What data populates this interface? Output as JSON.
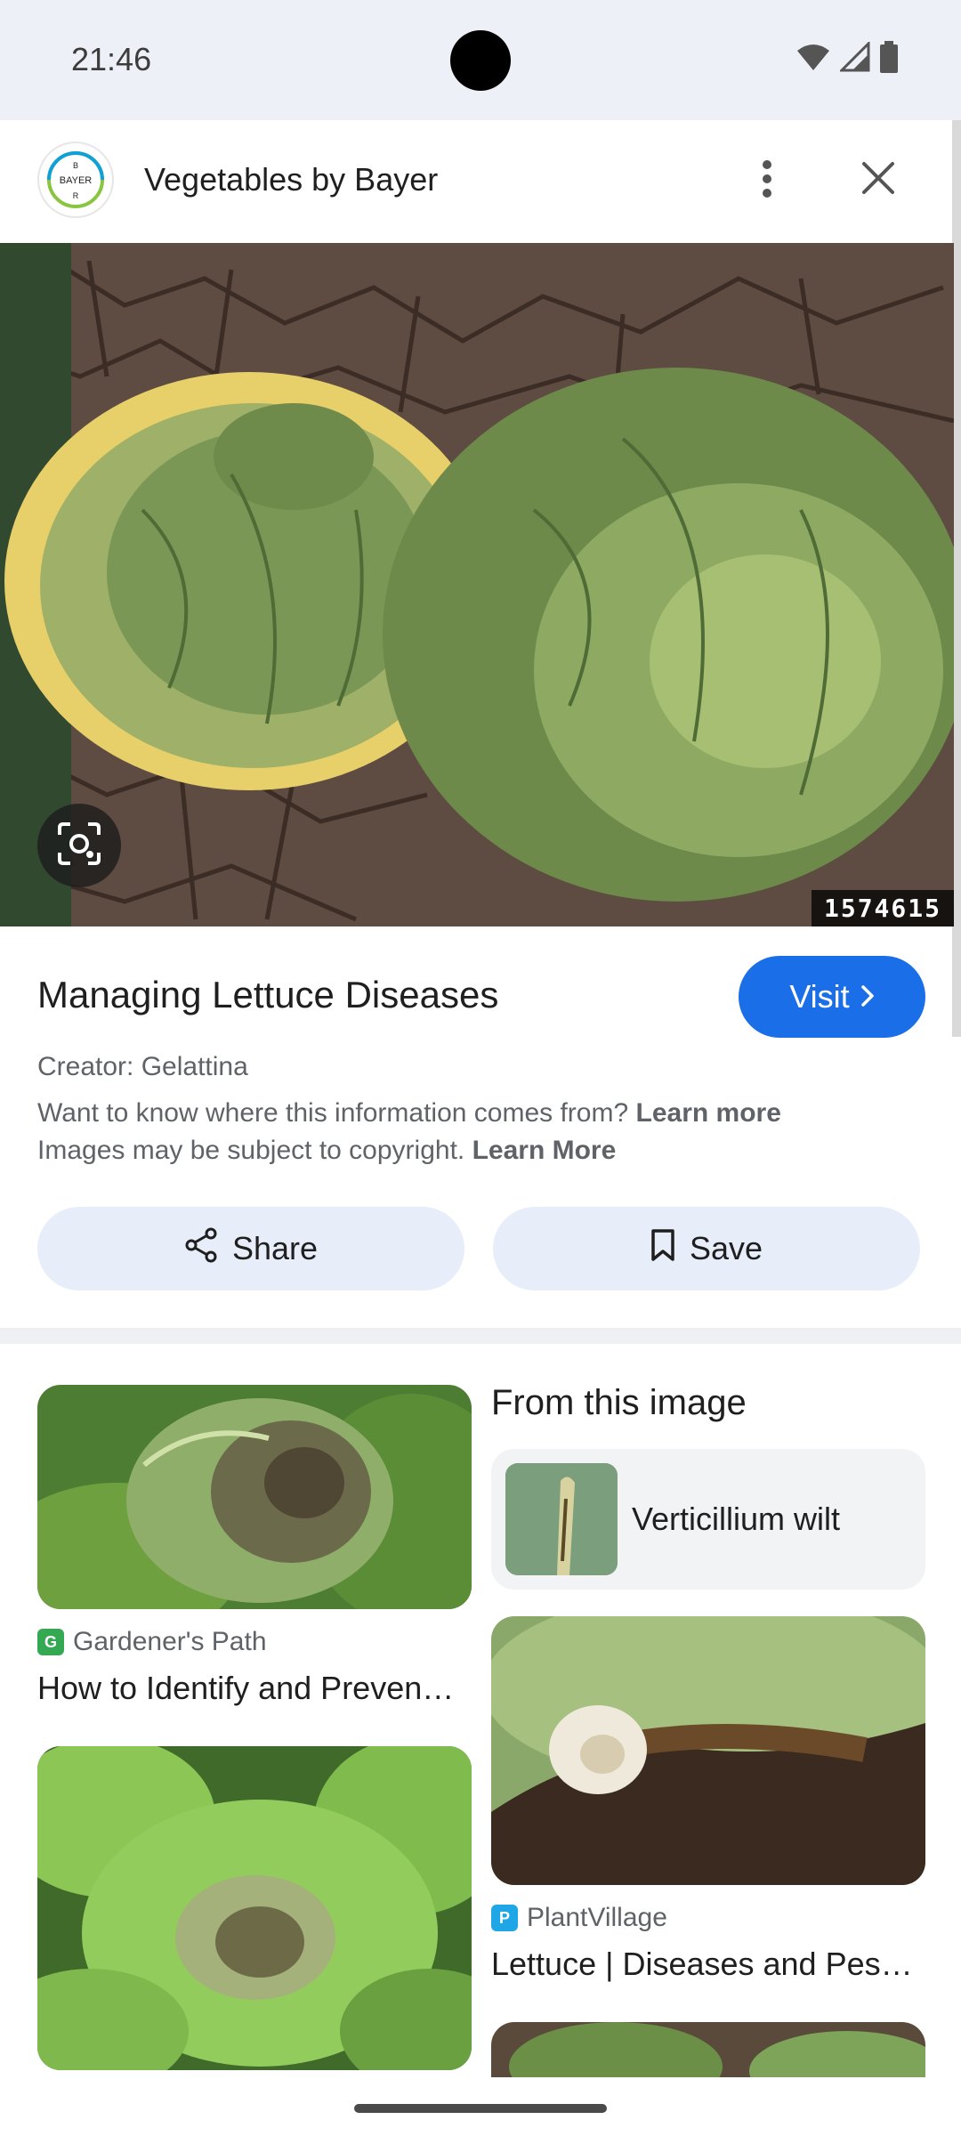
{
  "status_bar": {
    "time": "21:46"
  },
  "header": {
    "title": "Vegetables by Bayer",
    "logo_text": "BAYER"
  },
  "hero": {
    "image_id": "1574615"
  },
  "result": {
    "title": "Managing Lettuce Diseases",
    "visit_label": "Visit",
    "creator": "Creator: Gelattina",
    "info_text": "Want to know where this information comes from?",
    "info_link": "Learn more",
    "copyright_text": "Images may be subject to copyright.",
    "copyright_link": "Learn More",
    "share_label": "Share",
    "save_label": "Save"
  },
  "related": {
    "left": [
      {
        "source": "Gardener's Path",
        "title": "How to Identify and Preven…"
      }
    ],
    "right": [
      {
        "source": "PlantVillage",
        "title": "Lettuce | Diseases and Pes…"
      }
    ],
    "from_image_heading": "From this image",
    "from_image_chip": "Verticillium wilt"
  },
  "colors": {
    "accent": "#1a6ee8",
    "pill_bg": "#e7edf9",
    "status_bg": "#eef0f8"
  },
  "icons": [
    "wifi-icon",
    "signal-icon",
    "battery-icon",
    "more-vert-icon",
    "close-icon",
    "lens-icon",
    "chevron-right-icon",
    "share-icon",
    "bookmark-icon"
  ]
}
